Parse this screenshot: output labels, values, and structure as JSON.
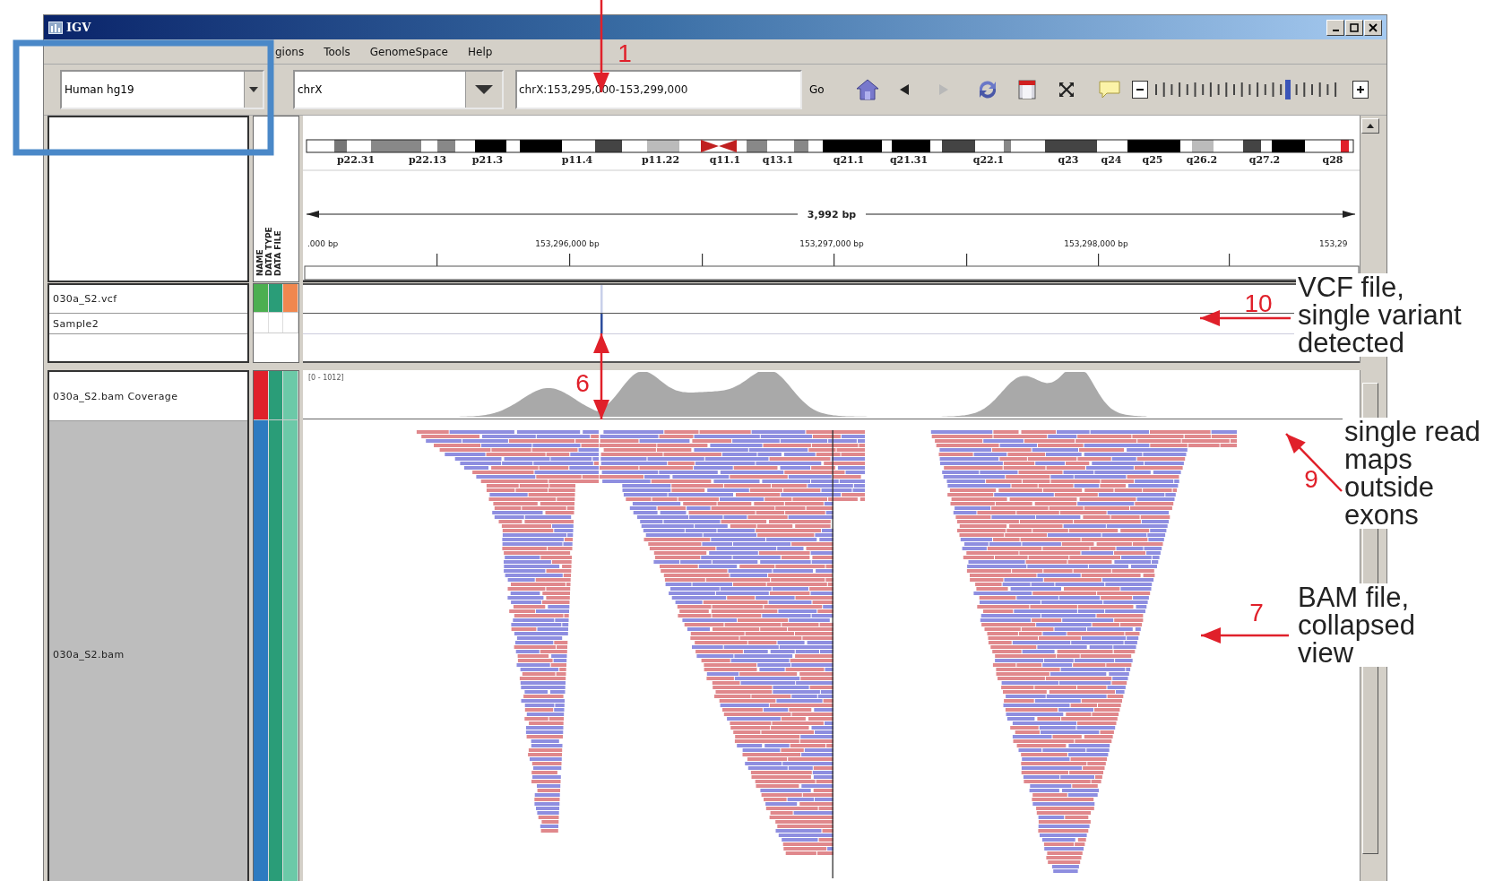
{
  "window": {
    "title": "IGV"
  },
  "menu": [
    {
      "label": "gions"
    },
    {
      "label": "Tools"
    },
    {
      "label": "GenomeSpace"
    },
    {
      "label": "Help"
    }
  ],
  "toolbar": {
    "genome": "Human hg19",
    "chromosome": "chrX",
    "locus": "chrX:153,295,000-153,299,000",
    "go": "Go",
    "buttons": [
      {
        "kind": "home",
        "disabled": false
      },
      {
        "kind": "back",
        "disabled": false
      },
      {
        "kind": "forward",
        "disabled": true
      },
      {
        "kind": "refresh",
        "disabled": false
      },
      {
        "kind": "region",
        "disabled": false
      },
      {
        "kind": "resize",
        "disabled": false
      },
      {
        "kind": "popup",
        "disabled": false
      }
    ],
    "zoom": {
      "level": 0.72
    }
  },
  "ideogram": {
    "bands": [
      "p22.31",
      "p22.13",
      "p21.3",
      "p11.4",
      "p11.22",
      "q11.1",
      "q13.1",
      "q21.1",
      "q21.31",
      "q22.1",
      "q23",
      "q24",
      "q25",
      "q26.2",
      "q27.2",
      "q28"
    ]
  },
  "ruler": {
    "span": "3,992 bp",
    "ticks": [
      ".000 bp",
      "153,296,000 bp",
      "153,297,000 bp",
      "153,298,000 bp",
      "153,29"
    ]
  },
  "attribute_headers": [
    "NAME",
    "DATA TYPE",
    "DATA FILE"
  ],
  "panels": [
    {
      "tracks": [
        {
          "kind": "variant",
          "name": "030a_S2.vcf",
          "attributes": [
            {
              "color": "#4caf50"
            },
            {
              "color": "#2a9d78"
            },
            {
              "color": "#f0874f"
            }
          ]
        },
        {
          "kind": "sample",
          "name": "Sample2"
        }
      ]
    },
    {
      "tracks": [
        {
          "kind": "coverage",
          "name": "030a_S2.bam Coverage",
          "range": "[0 - 1012]",
          "attributes": [
            {
              "color": "#e0202a"
            },
            {
              "color": "#2a9d78"
            },
            {
              "color": "#6cc9a8"
            }
          ]
        },
        {
          "kind": "alignment",
          "name": "030a_S2.bam",
          "attributes": [
            {
              "color": "#2e7bc0"
            },
            {
              "color": "#2a9d78"
            },
            {
              "color": "#6cc9a8"
            }
          ]
        }
      ]
    }
  ],
  "annotations": [
    {
      "number": "1"
    },
    {
      "number": "10",
      "lines": [
        "VCF file,",
        "single variant",
        "detected"
      ]
    },
    {
      "number": "6"
    },
    {
      "number": "9",
      "lines": [
        "single read",
        "maps",
        "outside",
        "exons"
      ]
    },
    {
      "number": "7",
      "lines": [
        "BAM file,",
        "collapsed",
        "view"
      ]
    }
  ]
}
